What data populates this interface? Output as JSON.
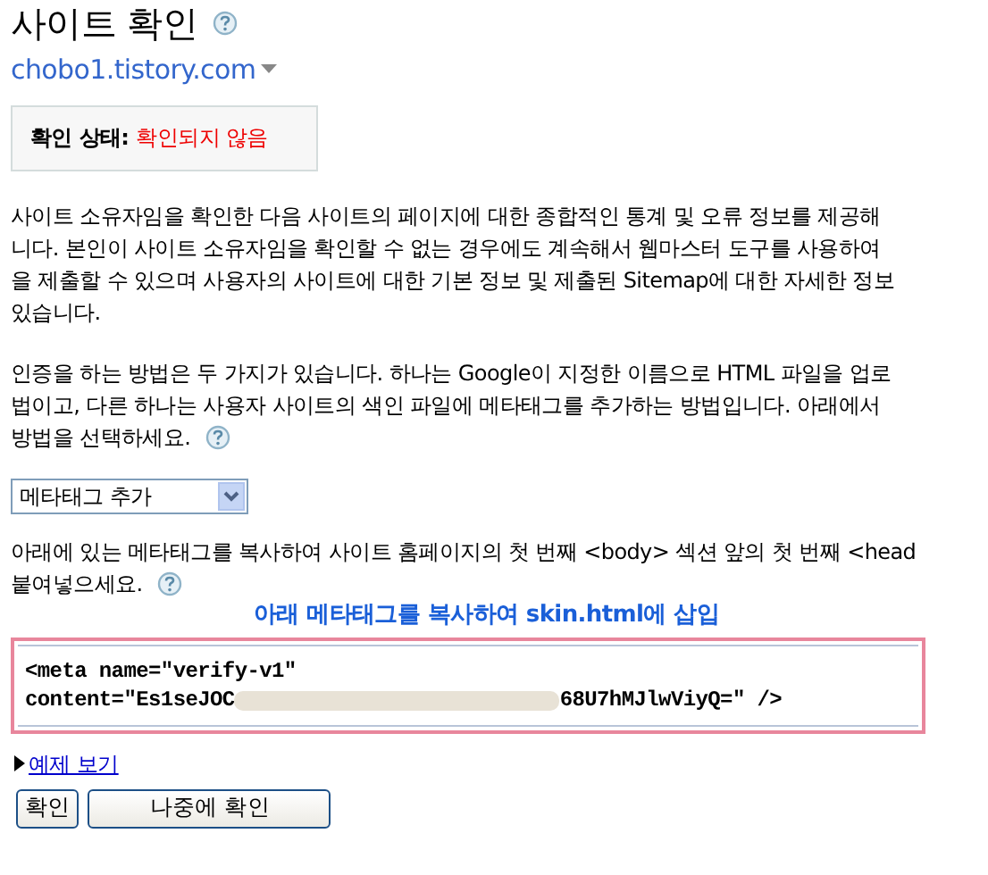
{
  "title": "사이트 확인",
  "site": {
    "url": "chobo1.tistory.com"
  },
  "status": {
    "label": "확인 상태:",
    "value": "확인되지 않음"
  },
  "intro_lines": [
    "사이트 소유자임을 확인한 다음 사이트의 페이지에 대한 종합적인 통계 및 오류 정보를 제공해",
    "니다. 본인이 사이트 소유자임을 확인할 수 없는 경우에도 계속해서 웹마스터 도구를 사용하여",
    "을 제출할 수 있으며 사용자의 사이트에 대한 기본 정보 및 제출된 Sitemap에 대한 자세한 정보",
    "있습니다."
  ],
  "method_lines": [
    "인증을 하는 방법은 두 가지가 있습니다. 하나는 Google이 지정한 이름으로 HTML 파일을 업로",
    "법이고, 다른 하나는 사용자 사이트의 색인 파일에 메타태그를 추가하는 방법입니다. 아래에서",
    "방법을 선택하세요."
  ],
  "method_select": {
    "value": "메타태그 추가"
  },
  "instruction_lines": [
    "아래에 있는 메타태그를 복사하여 사이트 홈페이지의 첫 번째 <body> 섹션 앞의 첫 번째 <head",
    "붙여넣으세요."
  ],
  "annotation": "아래 메타태그를 복사하여 skin.html에 삽입",
  "code": {
    "line_1": "<meta name=\"verify-v1\"",
    "line_2_start": "content=\"Es1seJOC",
    "line_2_end": "68U7hMJlwViyQ=\" />"
  },
  "example_link": {
    "label": "예제 보기",
    "expanded": false
  },
  "buttons": [
    "확인",
    "나중에 확인"
  ]
}
